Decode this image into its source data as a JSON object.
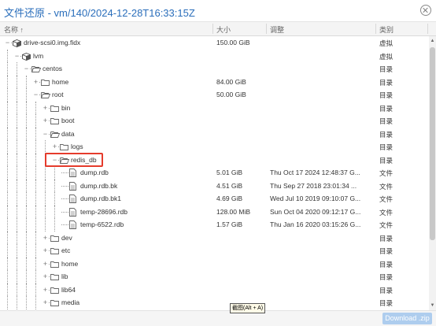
{
  "window": {
    "title": "文件还原 - vm/140/2024-12-28T16:33:15Z"
  },
  "columns": {
    "name": "名称 ↑",
    "size": "大小",
    "modified": "调整",
    "type": "类别"
  },
  "rows": [
    {
      "name": "drive-scsi0.img.fidx",
      "size": "150.00 GiB",
      "modified": "",
      "type": "虚拟",
      "icon": "disk-icon",
      "depth": 0,
      "expander": "−"
    },
    {
      "name": "lvm",
      "size": "",
      "modified": "",
      "type": "虚拟",
      "icon": "disk-icon",
      "depth": 1,
      "expander": "−"
    },
    {
      "name": "centos",
      "size": "",
      "modified": "",
      "type": "目录",
      "icon": "folder-open-icon",
      "depth": 2,
      "expander": "−"
    },
    {
      "name": "home",
      "size": "84.00 GiB",
      "modified": "",
      "type": "目录",
      "icon": "folder-icon",
      "depth": 3,
      "expander": "+"
    },
    {
      "name": "root",
      "size": "50.00 GiB",
      "modified": "",
      "type": "目录",
      "icon": "folder-open-icon",
      "depth": 3,
      "expander": "−"
    },
    {
      "name": "bin",
      "size": "",
      "modified": "",
      "type": "目录",
      "icon": "folder-icon",
      "depth": 4,
      "expander": "+"
    },
    {
      "name": "boot",
      "size": "",
      "modified": "",
      "type": "目录",
      "icon": "folder-icon",
      "depth": 4,
      "expander": "+"
    },
    {
      "name": "data",
      "size": "",
      "modified": "",
      "type": "目录",
      "icon": "folder-open-icon",
      "depth": 4,
      "expander": "−"
    },
    {
      "name": "logs",
      "size": "",
      "modified": "",
      "type": "目录",
      "icon": "folder-icon",
      "depth": 5,
      "expander": "+"
    },
    {
      "name": "redis_db",
      "size": "",
      "modified": "",
      "type": "目录",
      "icon": "folder-open-icon",
      "depth": 5,
      "expander": "−"
    },
    {
      "name": "dump.rdb",
      "size": "5.01 GiB",
      "modified": "Thu Oct 17 2024 12:48:37 G...",
      "type": "文件",
      "icon": "file-icon",
      "depth": 6,
      "expander": ""
    },
    {
      "name": "dump.rdb.bk",
      "size": "4.51 GiB",
      "modified": "Thu Sep 27 2018 23:01:34 ...",
      "type": "文件",
      "icon": "file-icon",
      "depth": 6,
      "expander": ""
    },
    {
      "name": "dump.rdb.bk1",
      "size": "4.69 GiB",
      "modified": "Wed Jul 10 2019 09:10:07 G...",
      "type": "文件",
      "icon": "file-icon",
      "depth": 6,
      "expander": ""
    },
    {
      "name": "temp-28696.rdb",
      "size": "128.00 MiB",
      "modified": "Sun Oct 04 2020 09:12:17 G...",
      "type": "文件",
      "icon": "file-icon",
      "depth": 6,
      "expander": ""
    },
    {
      "name": "temp-6522.rdb",
      "size": "1.57 GiB",
      "modified": "Thu Jan 16 2020 03:15:26 G...",
      "type": "文件",
      "icon": "file-icon",
      "depth": 6,
      "expander": ""
    },
    {
      "name": "dev",
      "size": "",
      "modified": "",
      "type": "目录",
      "icon": "folder-icon",
      "depth": 4,
      "expander": "+"
    },
    {
      "name": "etc",
      "size": "",
      "modified": "",
      "type": "目录",
      "icon": "folder-icon",
      "depth": 4,
      "expander": "+"
    },
    {
      "name": "home",
      "size": "",
      "modified": "",
      "type": "目录",
      "icon": "folder-icon",
      "depth": 4,
      "expander": "+"
    },
    {
      "name": "lib",
      "size": "",
      "modified": "",
      "type": "目录",
      "icon": "folder-icon",
      "depth": 4,
      "expander": "+"
    },
    {
      "name": "lib64",
      "size": "",
      "modified": "",
      "type": "目录",
      "icon": "folder-icon",
      "depth": 4,
      "expander": "+"
    },
    {
      "name": "media",
      "size": "",
      "modified": "",
      "type": "目录",
      "icon": "folder-icon",
      "depth": 4,
      "expander": "+"
    }
  ],
  "tooltip": {
    "text": "截图(Alt + A)"
  },
  "footer": {
    "download_label": "Download .zip"
  },
  "colors": {
    "title": "#2a6ebb",
    "highlight": "#e53b2c",
    "download_bg": "#aecdee"
  }
}
